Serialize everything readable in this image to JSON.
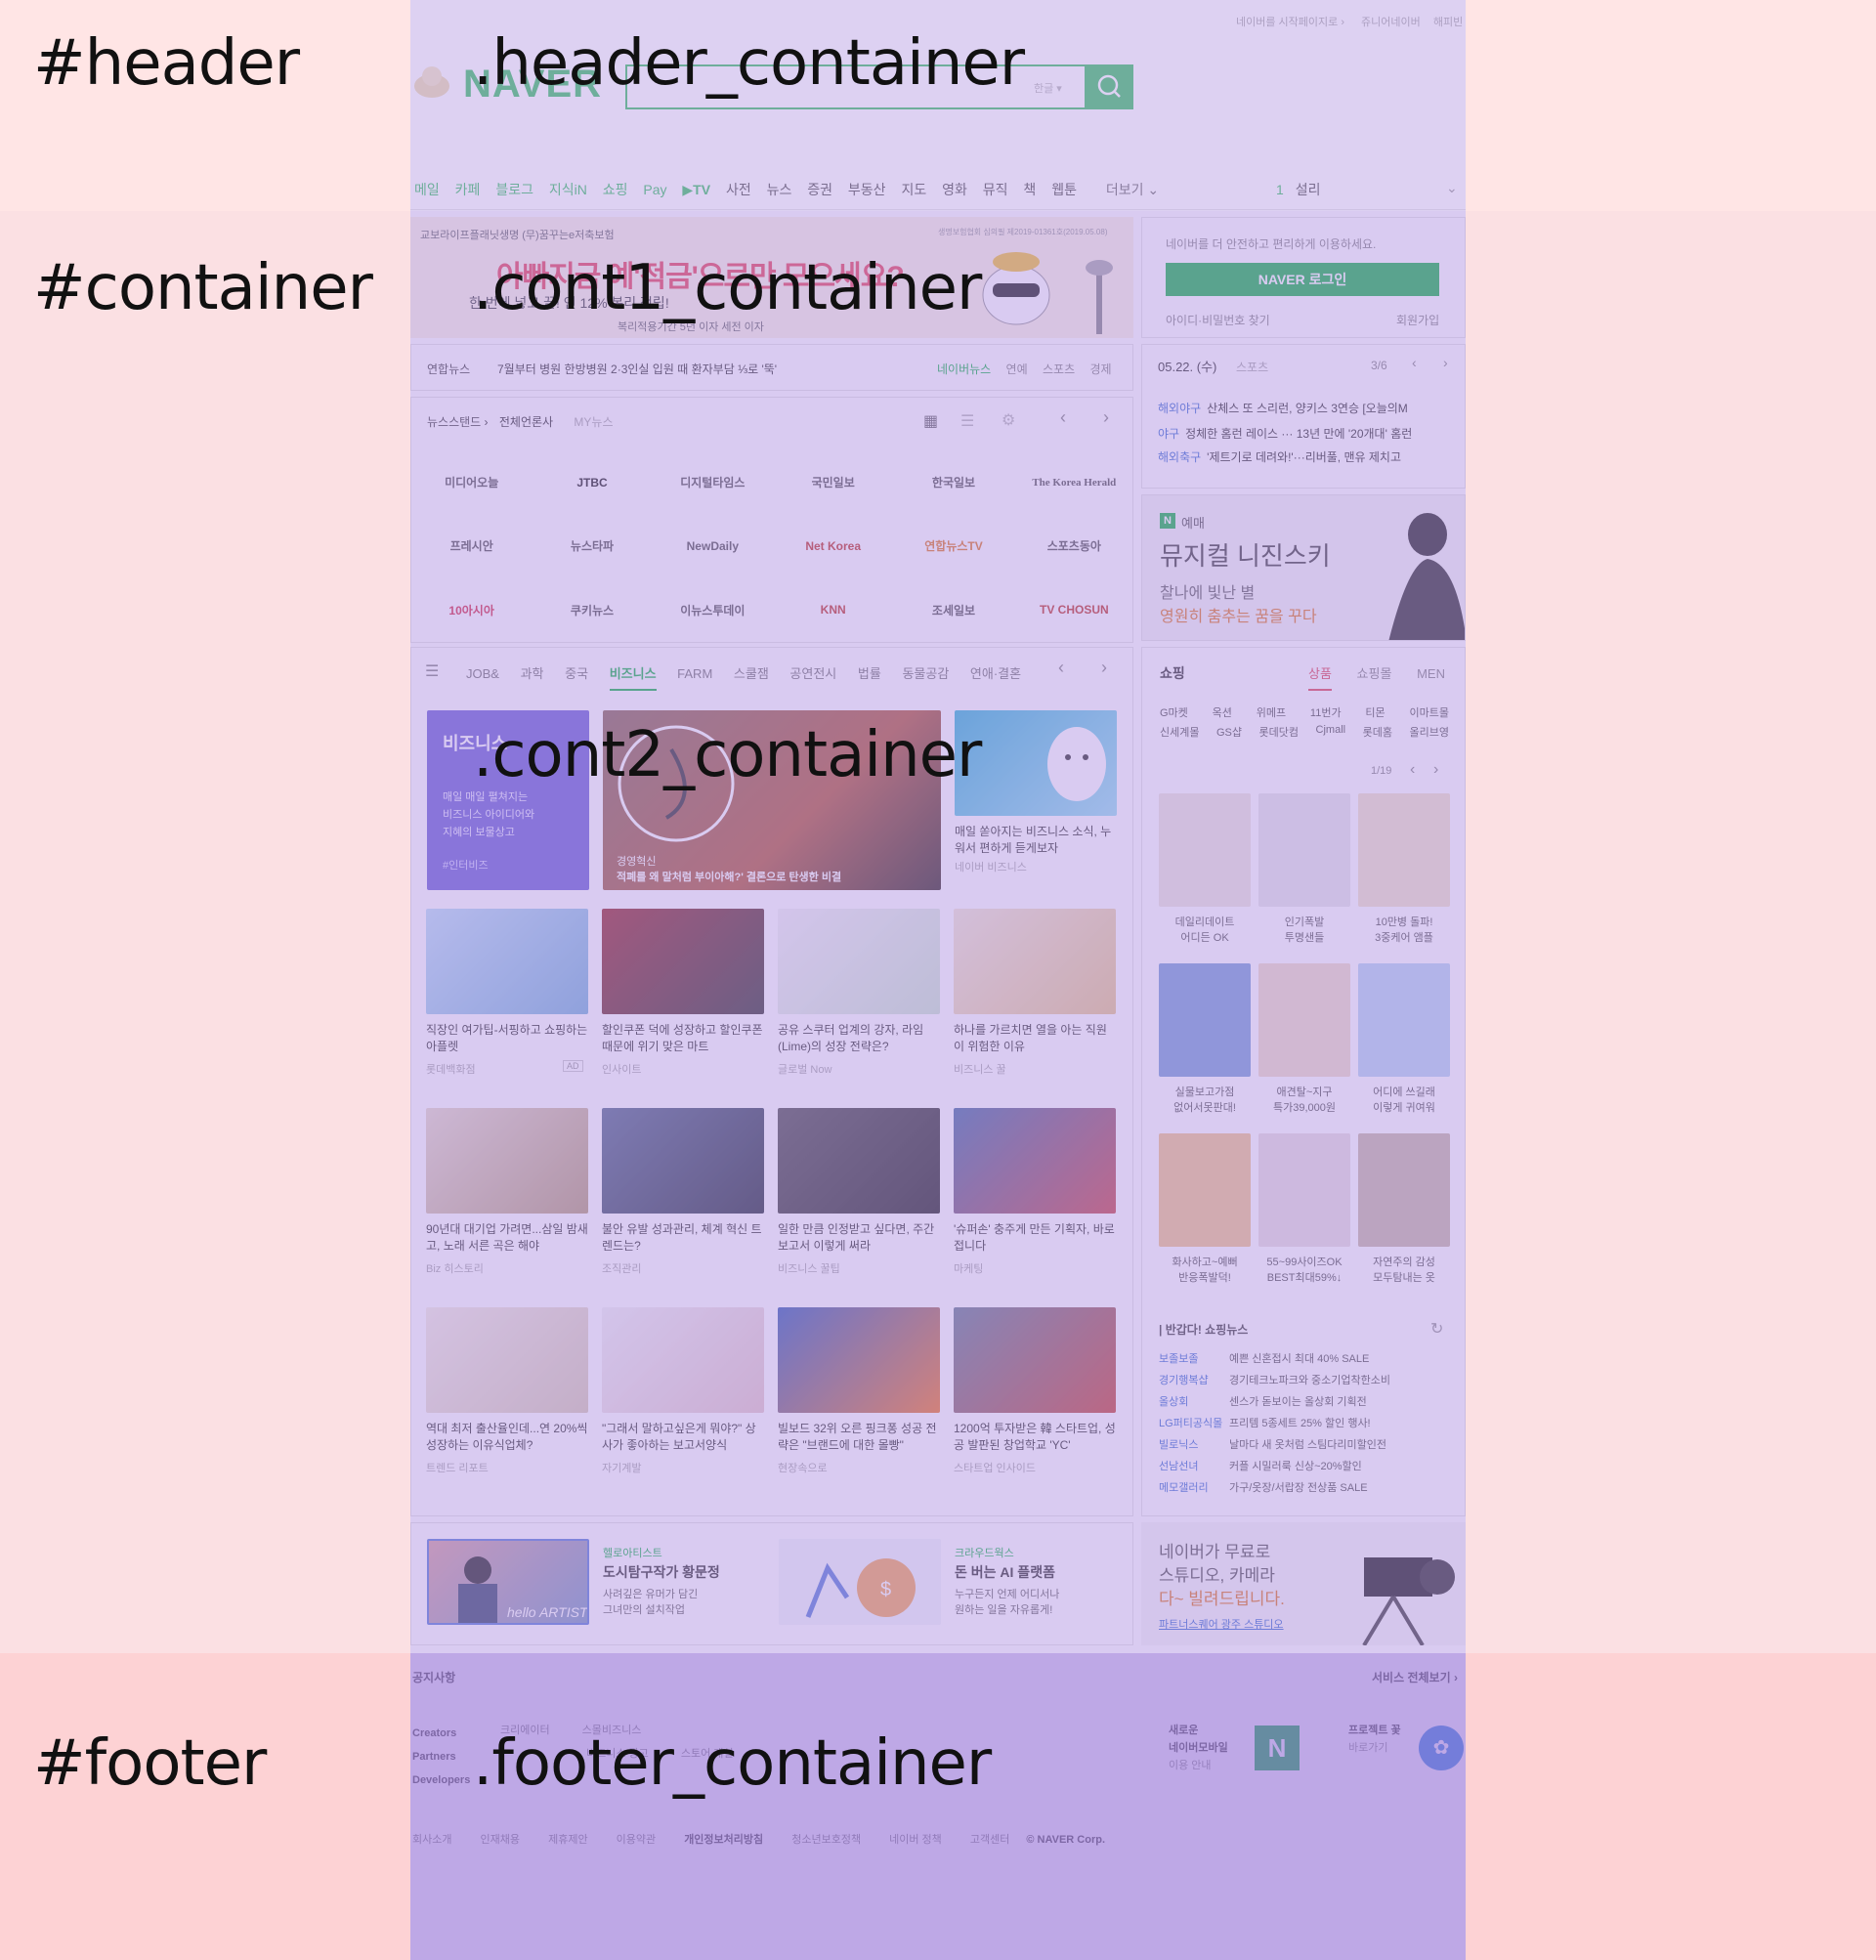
{
  "regions": {
    "header": "#header",
    "header_container": ".header_container",
    "container": "#container",
    "cont1_container": ".cont1_container",
    "cont2_container": ".cont2_container",
    "footer": "#footer",
    "footer_container": ".footer_container"
  },
  "colors": {
    "outer_band": "#ffd6d6",
    "container_overlay": "#c9b8f0",
    "footer_overlay": "#b39de6",
    "naver_green": "#19b64b"
  },
  "top_links": {
    "start": "네이버를 시작페이지로",
    "jr": "쥬니어네이버",
    "happy": "해피빈"
  },
  "logo": "NAVER",
  "search": {
    "lang": "한글",
    "icon": "search-icon"
  },
  "nav": {
    "items": [
      "메일",
      "카페",
      "블로그",
      "지식iN",
      "쇼핑",
      "Pay",
      "▶TV",
      "사전",
      "뉴스",
      "증권",
      "부동산",
      "지도",
      "영화",
      "뮤직",
      "책",
      "웹툰"
    ],
    "more": "더보기",
    "weather_num": "1",
    "weather_text": "설리"
  },
  "banner": {
    "top": "교보라이프플래닛생명 (무)꿈꾸는e저축보험",
    "note": "생명보험협회 심의필 제2019-01361호(2019.05.08)",
    "headline": "아빠지금 예'적금'으로만 모으세요?",
    "sub": "한 번에 넣고 끝! 연 12% 복리 적립!",
    "foot": "복리적용기간 5년 이자 세전 이자"
  },
  "login": {
    "msg": "네이버를 더 안전하고 편리하게 이용하세요.",
    "button": "NAVER 로그인",
    "find": "아이디·비밀번호 찾기",
    "join": "회원가입"
  },
  "headline_news": {
    "source": "연합뉴스",
    "text": "7월부터 병원 한방병원 2·3인실 입원 때 환자부담 ⅓로 '뚝'",
    "tabs": [
      "네이버뉴스",
      "연예",
      "스포츠",
      "경제"
    ]
  },
  "sports": {
    "date": "05.22. (수)",
    "cat": "스포츠",
    "page": "3/6",
    "items": [
      {
        "tag": "해외야구",
        "text": "산체스 또 스리런, 양키스 3연승 [오늘의M"
      },
      {
        "tag": "야구",
        "text": "정체한 홈런 레이스 ··· 13년 만에 '20개대' 홈런"
      },
      {
        "tag": "해외축구",
        "text": "'제트기로 데려와!'···리버풀, 맨유 제치고"
      }
    ]
  },
  "newsstand": {
    "title": "뉴스스탠드",
    "all": "전체언론사",
    "my": "MY뉴스",
    "press": [
      "미디어오늘",
      "JTBC",
      "디지털타임스",
      "국민일보",
      "한국일보",
      "The Korea Herald",
      "프레시안",
      "뉴스타파",
      "NewDaily",
      "Net Korea",
      "연합뉴스TV",
      "스포츠동아",
      "10아시아",
      "쿠키뉴스",
      "이뉴스투데이",
      "KNN",
      "조세일보",
      "TV CHOSUN"
    ]
  },
  "ad_musical": {
    "tag": "예매",
    "title": "뮤지컬 니진스키",
    "line1": "찰나에 빛난 별",
    "line2": "영원히 춤추는 꿈을 꾸다"
  },
  "theme": {
    "tabs": [
      "JOB&",
      "과학",
      "중국",
      "비즈니스",
      "FARM",
      "스쿨잼",
      "공연전시",
      "법률",
      "동물공감",
      "연애·결혼"
    ],
    "active": "비즈니스",
    "feature": {
      "title": "비즈니스",
      "desc1": "매일 매일 펼쳐지는",
      "desc2": "비즈니스 아이디어와",
      "desc3": "지혜의 보물상고",
      "src": "#인터비즈"
    },
    "main_cap1": "경영혁신",
    "main_cap2": "적폐를 왜 말처럼 부이아해?' 결론으로 탄생한 비결",
    "side_cap": "매일 쏟아지는 비즈니스 소식, 누워서 편하게 듣게보자",
    "side_src": "네이버 비즈니스",
    "cards": [
      {
        "cap": "직장인 여가팁-서핑하고 쇼핑하는 아플렛",
        "src": "롯데백화점",
        "ad": "AD"
      },
      {
        "cap": "할인쿠폰 덕에 성장하고 할인쿠폰 때문에 위기 맞은 마트",
        "src": "인사이트"
      },
      {
        "cap": "공유 스쿠터 업계의 강자, 라임(Lime)의 성장 전략은?",
        "src": "글로벌 Now"
      },
      {
        "cap": "하나를 가르치면 열을 아는 직원이 위험한 이유",
        "src": "비즈니스 꿀"
      },
      {
        "cap": "90년대 대기업 가려면...삼일 밤새고, 노래 서른 곡은 해야",
        "src": "Biz 히스토리"
      },
      {
        "cap": "불안 유발 성과관리, 체계 혁신 트렌드는?",
        "src": "조직관리"
      },
      {
        "cap": "일한 만큼 인정받고 싶다면, 주간 보고서 이렇게 써라",
        "src": "비즈니스 꿀팁"
      },
      {
        "cap": "'슈퍼손' 충주게 만든 기획자, 바로 접니다",
        "src": "마케팅"
      },
      {
        "cap": "역대 최저 출산율인데...연 20%씩 성장하는 이유식업체?",
        "src": "트렌드 리포트"
      },
      {
        "cap": "\"그래서 말하고싶은게 뭐야?\" 상사가 좋아하는 보고서양식",
        "src": "자기계발"
      },
      {
        "cap": "빌보드 32위 오른 핑크퐁 성공 전략은 \"브랜드에 대한 몰빵\"",
        "src": "현장속으로"
      },
      {
        "cap": "1200억 투자받은 韓 스타트업, 성공 발판된 창업학교 'YC'",
        "src": "스타트업 인사이드"
      }
    ]
  },
  "shopping": {
    "title": "쇼핑",
    "tabs": [
      "상품",
      "쇼핑몰",
      "MEN"
    ],
    "malls1": [
      "G마켓",
      "옥션",
      "위메프",
      "11번가",
      "티몬",
      "이마트몰"
    ],
    "malls2": [
      "신세계몰",
      "GS샵",
      "롯데닷컴",
      "Cjmall",
      "롯데홈",
      "올리브영"
    ],
    "page": "1/19",
    "items": [
      {
        "cap1": "데일리데이트",
        "cap2": "어디든 OK"
      },
      {
        "cap1": "인기폭발",
        "cap2": "투명샌들"
      },
      {
        "cap1": "10만병 돌파!",
        "cap2": "3중케어 앰플"
      },
      {
        "cap1": "실물보고가점",
        "cap2": "없어서못판대!"
      },
      {
        "cap1": "애견탈~지구",
        "cap2": "특가39,000원"
      },
      {
        "cap1": "어디에 쓰길래",
        "cap2": "이렇게 귀여워"
      },
      {
        "cap1": "화사하고~예뻐",
        "cap2": "반응폭발덕!"
      },
      {
        "cap1": "55~99사이즈OK",
        "cap2": "BEST최대59%↓"
      },
      {
        "cap1": "자연주의 감성",
        "cap2": "모두탐내는 옷"
      }
    ]
  },
  "shopping_news": {
    "title": "반갑다! 쇼핑뉴스",
    "items": [
      {
        "tag": "보졸보졸",
        "text": "예쁜 신혼접시 최대 40% SALE"
      },
      {
        "tag": "경기행복샵",
        "text": "경기테크노파크와 중소기업착한소비"
      },
      {
        "tag": "올상회",
        "text": "센스가 돋보이는 올상회 기획전"
      },
      {
        "tag": "LG퍼티공식몰",
        "text": "프리템 5종세트 25% 할인 행사!"
      },
      {
        "tag": "빌로닉스",
        "text": "날마다 새 옷처럼 스팀다리미할인전"
      },
      {
        "tag": "선남선녀",
        "text": "커플 시밀러룩 신상~20%할인"
      },
      {
        "tag": "메모갤러리",
        "text": "가구/옷장/서랍장 전상품 SALE"
      }
    ]
  },
  "bottom_promos": [
    {
      "tag": "헬로아티스트",
      "title": "도시탐구작가 황문정",
      "d1": "사려깊은 유머가 담긴",
      "d2": "그녀만의 설치작업"
    },
    {
      "tag": "크라우드웍스",
      "title": "돈 버는 AI 플랫폼",
      "d1": "누구든지 언제 어디서나",
      "d2": "원하는 일을 자유롭게!"
    }
  ],
  "ad_studio": {
    "line1": "네이버가 무료로",
    "line2": "스튜디오, 카메라",
    "line3": "다~ 빌려드립니다.",
    "link": "파트너스퀘어 광주 스튜디오"
  },
  "footer": {
    "notice": "공지사항",
    "all_services": "서비스 전체보기",
    "col1": [
      "Creators",
      "Partners",
      "Developers"
    ],
    "col2": [
      "크리에이터",
      "스몰비즈니스"
    ],
    "col3": [
      "비즈니스 광고",
      "스토어 개설"
    ],
    "app_title1": "새로운",
    "app_title2": "네이버모바일",
    "app_link": "이용 안내",
    "proj_title": "프로젝트 꽃",
    "proj_link": "바로가기",
    "links": [
      "회사소개",
      "인재채용",
      "제휴제안",
      "이용약관",
      "개인정보처리방침",
      "청소년보호정책",
      "네이버 정책",
      "고객센터"
    ],
    "corp": "© NAVER Corp."
  }
}
